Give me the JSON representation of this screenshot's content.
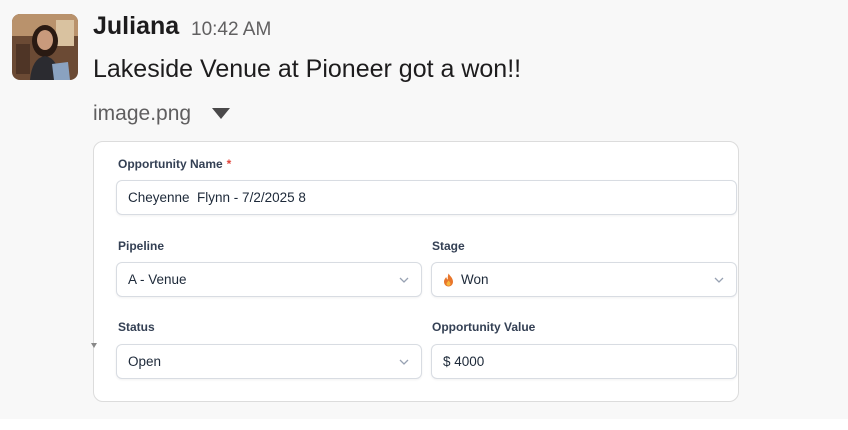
{
  "message": {
    "author": "Juliana",
    "time": "10:42 AM",
    "text": "Lakeside Venue at Pioneer got a won!!",
    "attachment": {
      "file_name": "image.png",
      "toggle_icon": "caret-down-icon"
    }
  },
  "form": {
    "opportunity_name": {
      "label": "Opportunity Name",
      "required_mark": "*",
      "value": "Cheyenne  Flynn - 7/2/2025 8"
    },
    "pipeline": {
      "label": "Pipeline",
      "value": "A - Venue"
    },
    "stage": {
      "label": "Stage",
      "value": "Won",
      "icon": "flame-icon"
    },
    "status": {
      "label": "Status",
      "value": "Open"
    },
    "opportunity_value": {
      "label": "Opportunity Value",
      "value": "$ 4000"
    }
  },
  "colors": {
    "required": "#e0443a",
    "background": "#f8f8f8",
    "flame": "#e8762b"
  }
}
